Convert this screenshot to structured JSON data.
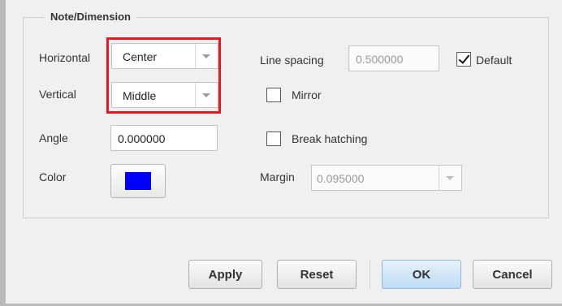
{
  "group": {
    "title": "Note/Dimension"
  },
  "horizontal": {
    "label": "Horizontal",
    "value": "Center"
  },
  "vertical": {
    "label": "Vertical",
    "value": "Middle"
  },
  "angle": {
    "label": "Angle",
    "value": "0.000000"
  },
  "color": {
    "label": "Color",
    "swatch": "#0000ff"
  },
  "line_spacing": {
    "label": "Line spacing",
    "value": "0.500000"
  },
  "default": {
    "label": "Default",
    "checked": true
  },
  "mirror": {
    "label": "Mirror",
    "checked": false
  },
  "break_hatching": {
    "label": "Break hatching",
    "checked": false
  },
  "margin": {
    "label": "Margin",
    "value": "0.095000"
  },
  "buttons": {
    "apply": "Apply",
    "reset": "Reset",
    "ok": "OK",
    "cancel": "Cancel"
  },
  "colors": {
    "highlight": "#e01b24",
    "accent": "#bcdcf3"
  }
}
